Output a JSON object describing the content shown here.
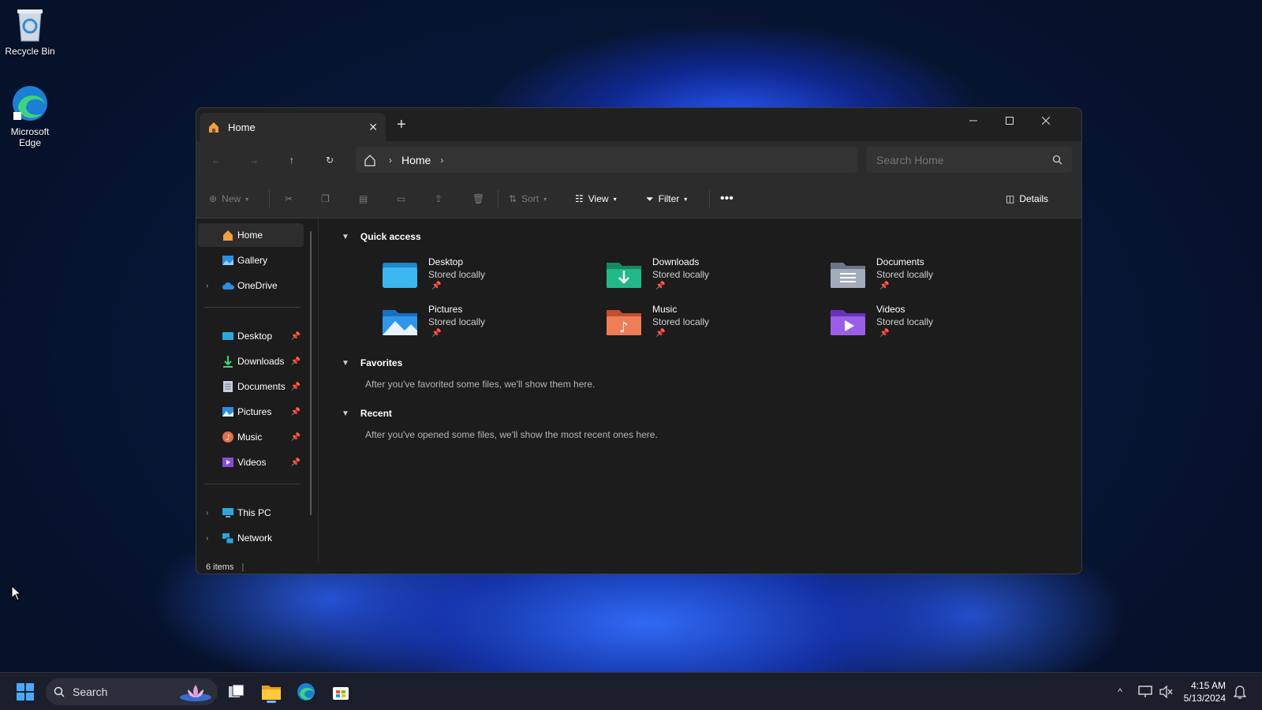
{
  "desktop": {
    "icons": [
      {
        "label": "Recycle Bin"
      },
      {
        "label": "Microsoft Edge"
      }
    ]
  },
  "window": {
    "tab_title": "Home",
    "breadcrumb": "Home",
    "search_placeholder": "Search Home",
    "toolbar": {
      "new_label": "New",
      "sort_label": "Sort",
      "view_label": "View",
      "filter_label": "Filter",
      "details_label": "Details"
    },
    "sidebar": {
      "top": [
        {
          "label": "Home"
        },
        {
          "label": "Gallery"
        },
        {
          "label": "OneDrive"
        }
      ],
      "pinned": [
        {
          "label": "Desktop"
        },
        {
          "label": "Downloads"
        },
        {
          "label": "Documents"
        },
        {
          "label": "Pictures"
        },
        {
          "label": "Music"
        },
        {
          "label": "Videos"
        }
      ],
      "bottom": [
        {
          "label": "This PC"
        },
        {
          "label": "Network"
        }
      ]
    },
    "sections": {
      "quick_access": "Quick access",
      "favorites": "Favorites",
      "favorites_empty": "After you've favorited some files, we'll show them here.",
      "recent": "Recent",
      "recent_empty": "After you've opened some files, we'll show the most recent ones here."
    },
    "quick_access": [
      {
        "name": "Desktop",
        "sub": "Stored locally",
        "color": "#29a8e0"
      },
      {
        "name": "Downloads",
        "sub": "Stored locally",
        "color": "#1fa67a"
      },
      {
        "name": "Documents",
        "sub": "Stored locally",
        "color": "#8a94a6"
      },
      {
        "name": "Pictures",
        "sub": "Stored locally",
        "color": "#2a8fe0"
      },
      {
        "name": "Music",
        "sub": "Stored locally",
        "color": "#e0704a"
      },
      {
        "name": "Videos",
        "sub": "Stored locally",
        "color": "#8a4ad6"
      }
    ],
    "status": "6 items"
  },
  "taskbar": {
    "search_label": "Search",
    "time": "4:15 AM",
    "date": "5/13/2024"
  }
}
